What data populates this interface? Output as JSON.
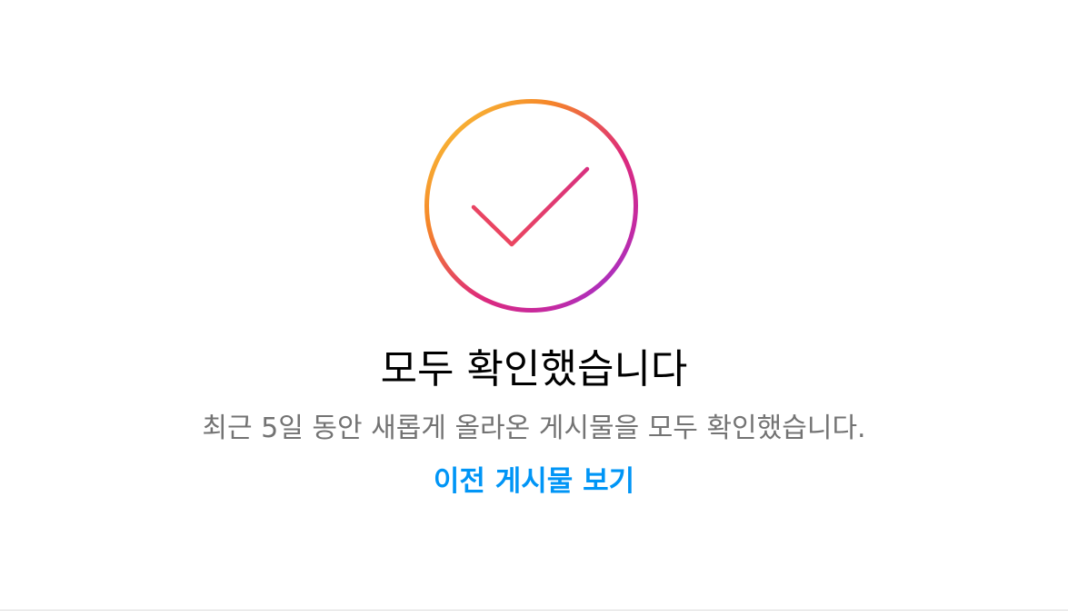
{
  "feed_end": {
    "icon": "checkmark-gradient-circle-icon",
    "title": "모두 확인했습니다",
    "subtitle": "최근 5일 동안 새롭게 올라온 게시물을 모두 확인했습니다.",
    "link_label": "이전 게시물 보기"
  },
  "colors": {
    "gradient": [
      "#f9d23c",
      "#f58529",
      "#dd2a7b",
      "#c32aa3",
      "#8134af"
    ],
    "link": "#0095f6",
    "subtitle": "#737373",
    "title": "#000000",
    "divider": "#dbdbdb"
  }
}
